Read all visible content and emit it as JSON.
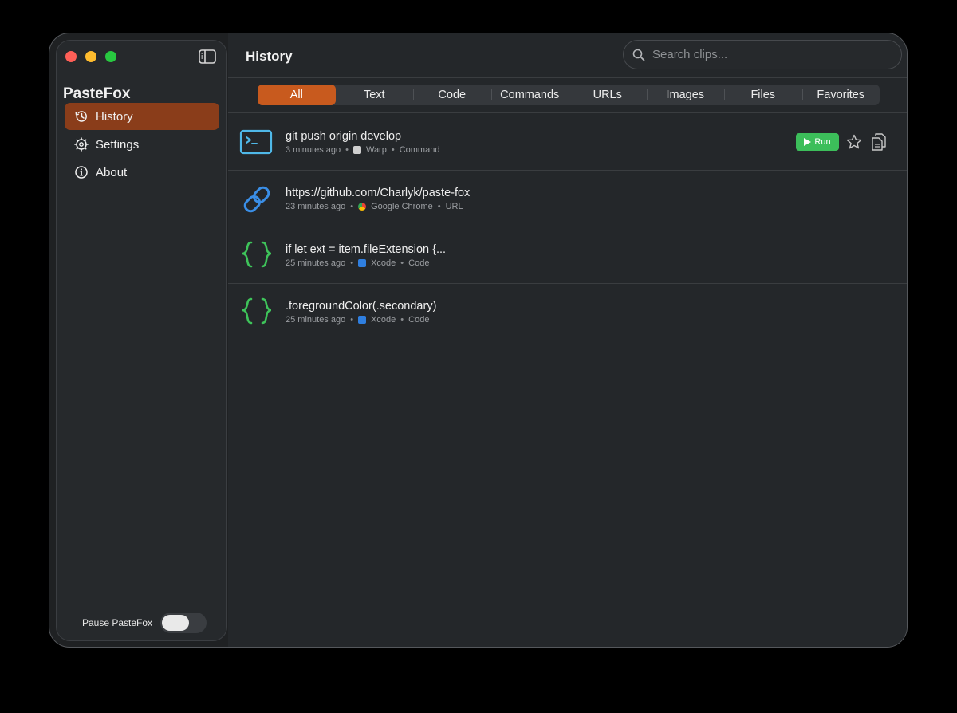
{
  "sidebar": {
    "app_title": "PasteFox",
    "items": [
      {
        "label": "History",
        "icon": "history-icon",
        "active": true
      },
      {
        "label": "Settings",
        "icon": "gear-icon",
        "active": false
      },
      {
        "label": "About",
        "icon": "info-icon",
        "active": false
      }
    ],
    "pause_label": "Pause PasteFox",
    "pause_enabled": false
  },
  "header": {
    "title": "History",
    "search_placeholder": "Search clips..."
  },
  "tabs": [
    {
      "label": "All",
      "active": true
    },
    {
      "label": "Text"
    },
    {
      "label": "Code"
    },
    {
      "label": "Commands"
    },
    {
      "label": "URLs"
    },
    {
      "label": "Images"
    },
    {
      "label": "Files"
    },
    {
      "label": "Favorites"
    }
  ],
  "clips": [
    {
      "title": "git push origin develop",
      "time": "3 minutes ago",
      "app": "Warp",
      "kind": "Command",
      "icon": "terminal-icon",
      "run_label": "Run"
    },
    {
      "title": "https://github.com/Charlyk/paste-fox",
      "time": "23 minutes ago",
      "app": "Google Chrome",
      "kind": "URL",
      "icon": "link-icon"
    },
    {
      "title": "if let ext = item.fileExtension {...",
      "time": "25 minutes ago",
      "app": "Xcode",
      "kind": "Code",
      "icon": "code-braces-icon"
    },
    {
      "title": ".foregroundColor(.secondary)",
      "time": "25 minutes ago",
      "app": "Xcode",
      "kind": "Code",
      "icon": "code-braces-icon"
    }
  ],
  "colors": {
    "accent": "#c85a1e",
    "active_nav": "#8a3d1a",
    "run_green": "#3cbe5a",
    "terminal_blue": "#4fb8e8",
    "link_blue": "#3a8ee6",
    "code_green": "#3ec45a"
  }
}
